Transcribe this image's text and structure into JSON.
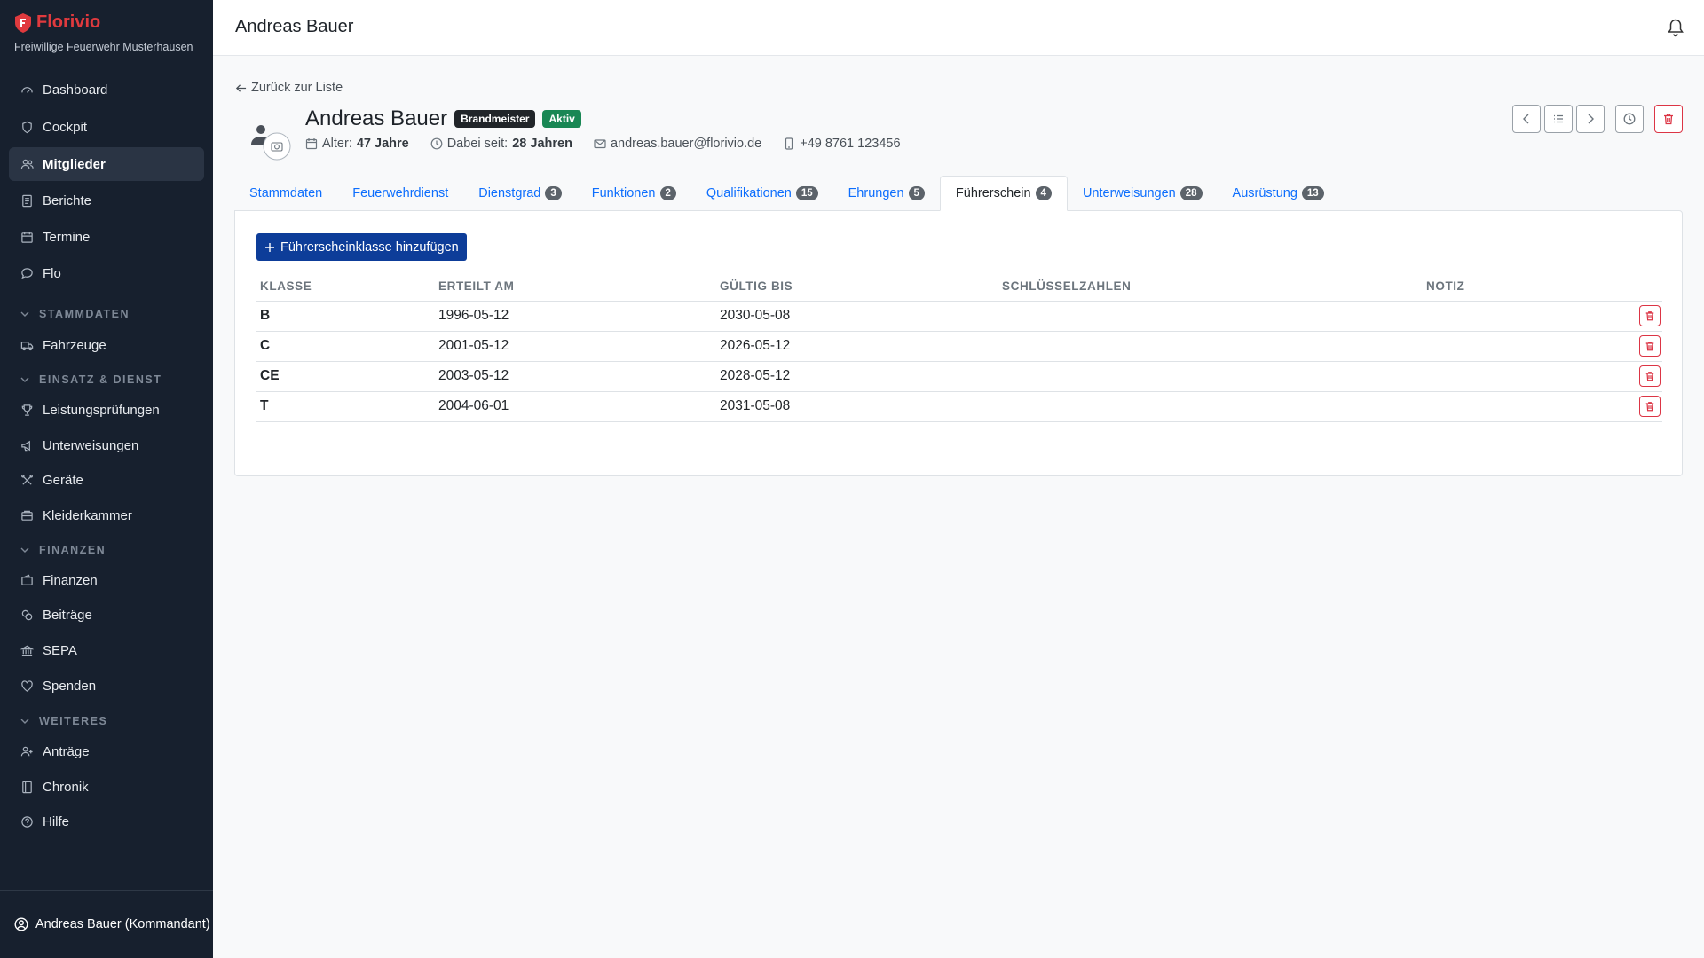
{
  "brand": {
    "name": "Florivio",
    "subtitle": "Freiwillige Feuerwehr Musterhausen",
    "color": "#e03a3e"
  },
  "sidebar": {
    "items": [
      {
        "label": "Dashboard",
        "icon": "dashboard-icon"
      },
      {
        "label": "Cockpit",
        "icon": "shield-icon"
      },
      {
        "label": "Mitglieder",
        "icon": "people-icon",
        "active": true
      },
      {
        "label": "Berichte",
        "icon": "document-icon"
      },
      {
        "label": "Termine",
        "icon": "calendar-icon"
      },
      {
        "label": "Flo",
        "icon": "chat-icon"
      }
    ],
    "sections": [
      {
        "title": "STAMMDATEN",
        "items": [
          {
            "label": "Fahrzeuge",
            "icon": "truck-icon"
          }
        ]
      },
      {
        "title": "EINSATZ & DIENST",
        "items": [
          {
            "label": "Leistungsprüfungen",
            "icon": "trophy-icon"
          },
          {
            "label": "Unterweisungen",
            "icon": "megaphone-icon"
          },
          {
            "label": "Geräte",
            "icon": "tools-icon"
          },
          {
            "label": "Kleiderkammer",
            "icon": "box-icon"
          }
        ]
      },
      {
        "title": "FINANZEN",
        "items": [
          {
            "label": "Finanzen",
            "icon": "wallet-icon"
          },
          {
            "label": "Beiträge",
            "icon": "coins-icon"
          },
          {
            "label": "SEPA",
            "icon": "bank-icon"
          },
          {
            "label": "Spenden",
            "icon": "heart-icon"
          }
        ]
      },
      {
        "title": "WEITERES",
        "items": [
          {
            "label": "Anträge",
            "icon": "person-add-icon"
          },
          {
            "label": "Chronik",
            "icon": "book-icon"
          },
          {
            "label": "Hilfe",
            "icon": "question-icon"
          }
        ]
      }
    ],
    "user": "Andreas Bauer (Kommandant)"
  },
  "header": {
    "title": "Andreas Bauer"
  },
  "member": {
    "back_label": "Zurück zur Liste",
    "name": "Andreas Bauer",
    "rank_badge": "Brandmeister",
    "status_badge": "Aktiv",
    "age_label": "Alter:",
    "age_value": "47 Jahre",
    "since_label": "Dabei seit:",
    "since_value": "28 Jahren",
    "email": "andreas.bauer@florivio.de",
    "phone": "+49 8761 123456"
  },
  "tabs": [
    {
      "label": "Stammdaten",
      "count": null
    },
    {
      "label": "Feuerwehrdienst",
      "count": null
    },
    {
      "label": "Dienstgrad",
      "count": "3"
    },
    {
      "label": "Funktionen",
      "count": "2"
    },
    {
      "label": "Qualifikationen",
      "count": "15"
    },
    {
      "label": "Ehrungen",
      "count": "5"
    },
    {
      "label": "Führerschein",
      "count": "4",
      "active": true
    },
    {
      "label": "Unterweisungen",
      "count": "28"
    },
    {
      "label": "Ausrüstung",
      "count": "13"
    }
  ],
  "license": {
    "add_button": "Führerscheinklasse hinzufügen",
    "columns": [
      "KLASSE",
      "ERTEILT AM",
      "GÜLTIG BIS",
      "SCHLÜSSELZAHLEN",
      "NOTIZ"
    ],
    "rows": [
      {
        "klasse": "B",
        "erteilt": "1996-05-12",
        "gueltig": "2030-05-08",
        "schluessel": "",
        "notiz": ""
      },
      {
        "klasse": "C",
        "erteilt": "2001-05-12",
        "gueltig": "2026-05-12",
        "schluessel": "",
        "notiz": ""
      },
      {
        "klasse": "CE",
        "erteilt": "2003-05-12",
        "gueltig": "2028-05-12",
        "schluessel": "",
        "notiz": ""
      },
      {
        "klasse": "T",
        "erteilt": "2004-06-01",
        "gueltig": "2031-05-08",
        "schluessel": "",
        "notiz": ""
      }
    ]
  }
}
